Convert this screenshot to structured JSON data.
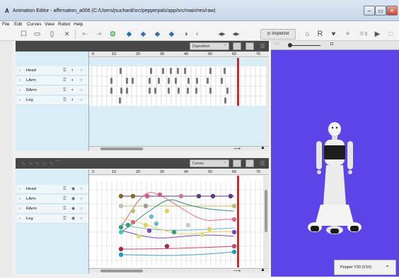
{
  "window": {
    "title": "Animation Editor - affirmation_a006 (C:/Users/jsuchard/src/pepperpals/app/src/main/res/raw)",
    "app_letter": "A",
    "minimize_label": "–",
    "maximize_label": "▭",
    "close_label": "✕"
  },
  "menu": [
    "File",
    "Edit",
    "Curves",
    "View",
    "Robot",
    "Help"
  ],
  "toolbar": {
    "inspector_label": "Inspector",
    "extra_letter": "R"
  },
  "dopesheet": {
    "mode_label": "Dopesheet",
    "ruler_ticks": [
      "0",
      "10",
      "20",
      "30",
      "40",
      "50",
      "60",
      "70"
    ],
    "tracks": [
      "Head",
      "LArm",
      "RArm",
      "Leg"
    ]
  },
  "curves": {
    "mode_label": "Curves",
    "ruler_ticks": [
      "0",
      "10",
      "20",
      "30",
      "40",
      "50",
      "60",
      "70"
    ],
    "tracks": [
      "Head",
      "LArm",
      "RArm",
      "Leg"
    ]
  },
  "inspector": {
    "robot_model": "Pepper Y20 (V10)"
  },
  "colors": {
    "viewport_bg": "#5b45e8",
    "playhead": "#e02020",
    "keyframe": "#8a8a8a"
  }
}
